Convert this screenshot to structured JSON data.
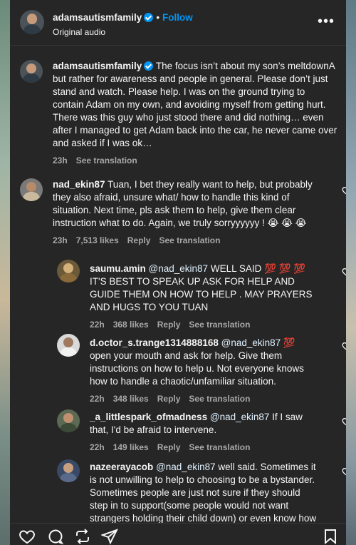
{
  "header": {
    "username": "adamsautismfamily",
    "follow_label": "Follow",
    "separator": "•",
    "audio_label": "Original audio",
    "more_icon": "more-horizontal-icon"
  },
  "caption": {
    "username": "adamsautismfamily",
    "text": "The focus isn’t about my son’s meltdownA but rather for awareness and people in general. Please don’t just stand and watch. Please help. I was on the ground trying to contain Adam on my own, and avoiding myself from getting hurt. There was this guy who just stood there and did nothing… even after I managed to get Adam back into the car, he never came over and asked if I was ok…",
    "time": "23h",
    "see_translation": "See translation"
  },
  "comments": [
    {
      "username": "nad_ekin87",
      "text": "Tuan, I bet they really want to help, but probably they also afraid, unsure what/ how to handle this kind of situation. Next time, pls ask them to help, give them clear instruction what to do. Again, we truly sorryyyyyy ! 😭 😭 😭",
      "time": "23h",
      "likes": "7,513 likes",
      "reply": "Reply",
      "see_translation": "See translation"
    }
  ],
  "replies": [
    {
      "username": "saumu.amin",
      "mention": "@nad_ekin87",
      "text": "WELL SAID 💯 💯 💯 IT'S BEST TO SPEAK UP ASK FOR HELP AND GUIDE THEM ON HOW TO HELP . MAY PRAYERS AND HUGS TO YOU TUAN",
      "time": "22h",
      "likes": "368 likes",
      "reply": "Reply",
      "see_translation": "See translation"
    },
    {
      "username": "d.octor_s.trange1314888168",
      "mention": "@nad_ekin87",
      "text": "💯 open your mouth and ask for help. Give them instructions on how to help u. Not everyone knows how to handle a chaotic/unfamiliar situation.",
      "time": "22h",
      "likes": "348 likes",
      "reply": "Reply",
      "see_translation": "See translation"
    },
    {
      "username": "_a_littlespark_ofmadness",
      "mention": "@nad_ekin87",
      "text": "If I saw that, I'd be afraid to intervene.",
      "time": "22h",
      "likes": "149 likes",
      "reply": "Reply",
      "see_translation": "See translation"
    },
    {
      "username": "nazeerayacob",
      "mention": "@nad_ekin87",
      "text": "well said. Sometimes it is not unwilling to help to choosing to be a bystander. Sometimes people are just not sure if they should step in to support(some people would not want strangers holding their child down) or even know how to help or"
    }
  ],
  "footer": {
    "icons": [
      "heart-icon",
      "comment-icon",
      "share-repost-icon",
      "send-icon",
      "bookmark-icon"
    ]
  },
  "colors": {
    "background": "#262626",
    "text": "#f5f5f5",
    "muted": "#a8a8a8",
    "accent": "#0095f6",
    "mention": "#e0f1ff"
  }
}
